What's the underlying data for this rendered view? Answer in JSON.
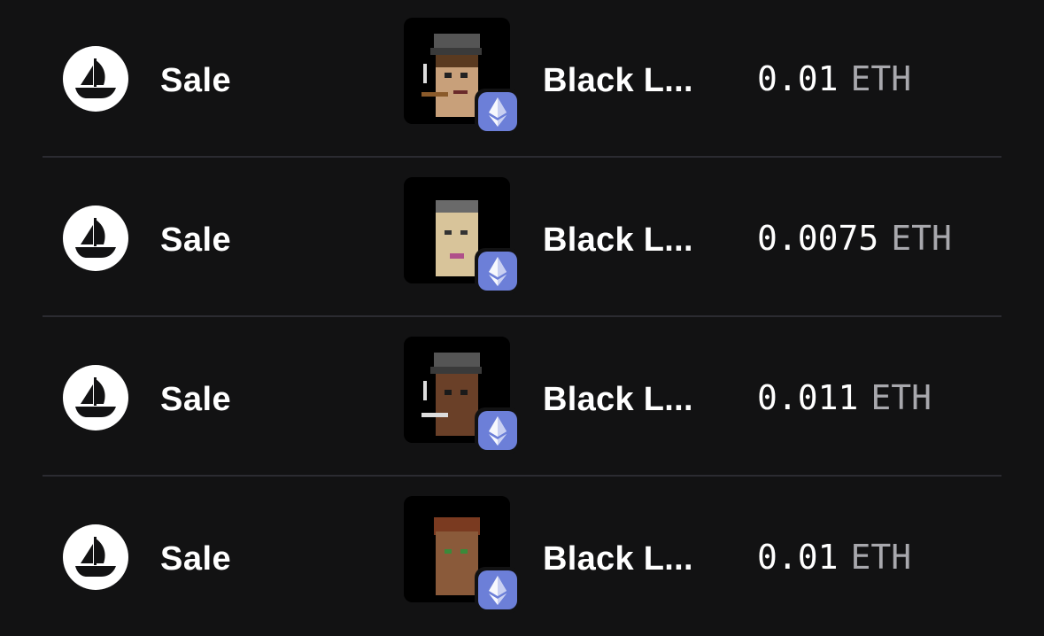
{
  "activity": {
    "rows": [
      {
        "event": "Sale",
        "item_name": "Black L...",
        "amount": "0.01",
        "currency": "ETH",
        "thumb_icon": "nft-avatar-thumbnail",
        "chain_icon": "ethereum-icon",
        "marketplace_icon": "opensea-logo-icon"
      },
      {
        "event": "Sale",
        "item_name": "Black L...",
        "amount": "0.0075",
        "currency": "ETH",
        "thumb_icon": "nft-avatar-thumbnail",
        "chain_icon": "ethereum-icon",
        "marketplace_icon": "opensea-logo-icon"
      },
      {
        "event": "Sale",
        "item_name": "Black L...",
        "amount": "0.011",
        "currency": "ETH",
        "thumb_icon": "nft-avatar-thumbnail",
        "chain_icon": "ethereum-icon",
        "marketplace_icon": "opensea-logo-icon"
      },
      {
        "event": "Sale",
        "item_name": "Black L...",
        "amount": "0.01",
        "currency": "ETH",
        "thumb_icon": "nft-avatar-thumbnail",
        "chain_icon": "ethereum-icon",
        "marketplace_icon": "opensea-logo-icon"
      }
    ]
  },
  "colors": {
    "background": "#121213",
    "divider": "#2b2b31",
    "eth_badge": "#6c7fd8",
    "currency_text": "#a8a8ad"
  }
}
